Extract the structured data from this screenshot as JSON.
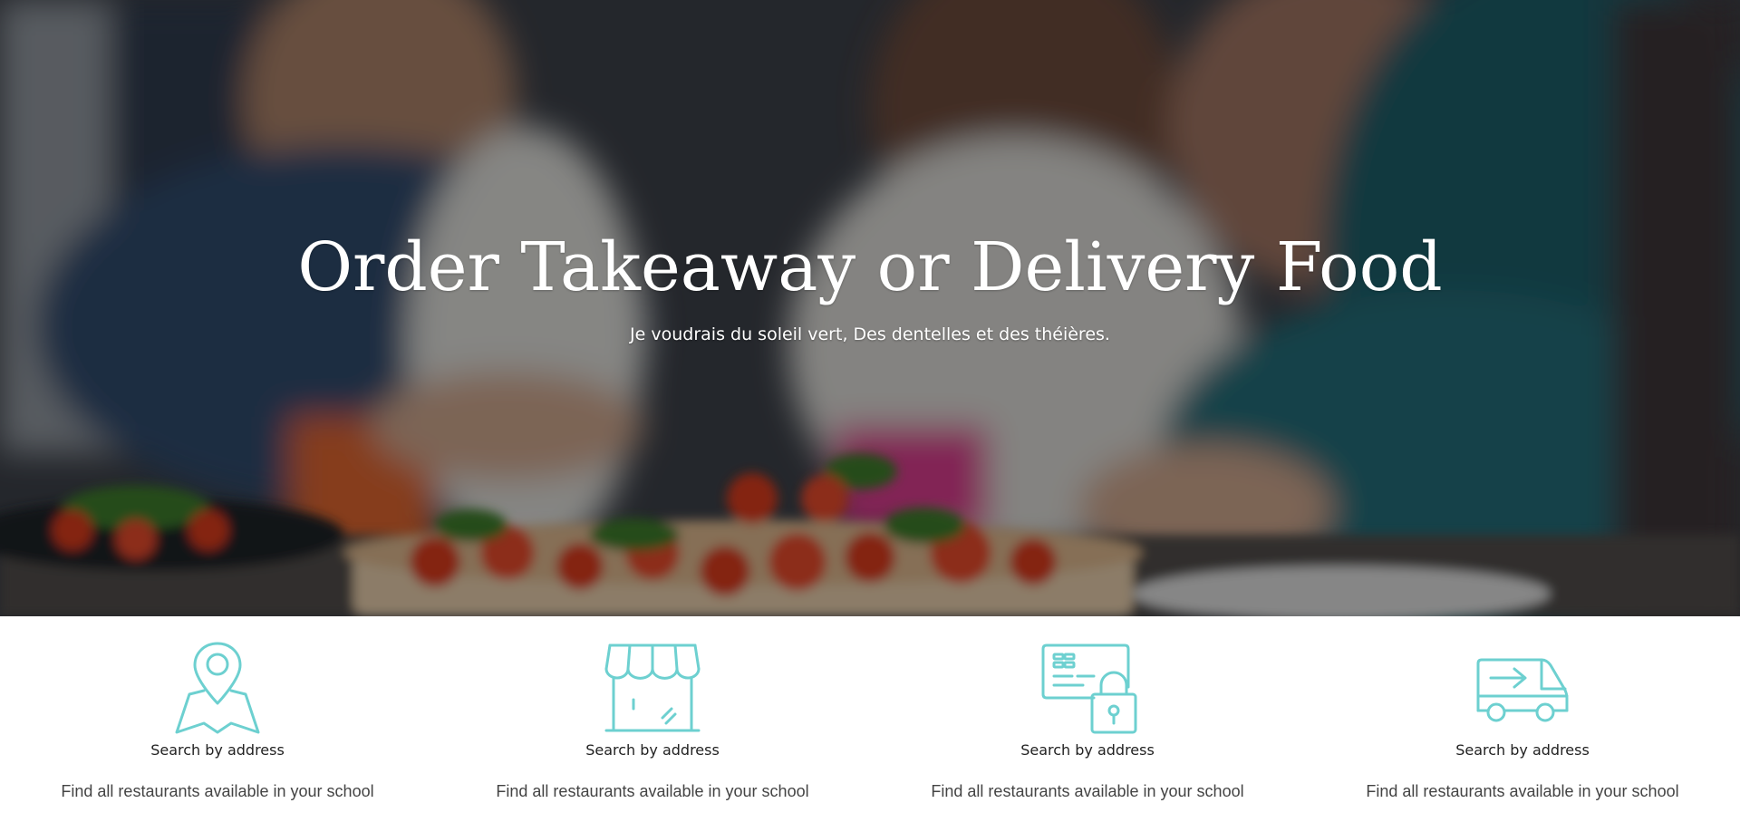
{
  "hero": {
    "title": "Order Takeaway or Delivery Food",
    "subtitle": "Je voudrais du soleil vert, Des dentelles et des théières."
  },
  "features": [
    {
      "icon": "map-pin-icon",
      "title": "Search by address",
      "description": "Find all restaurants available in your school"
    },
    {
      "icon": "storefront-icon",
      "title": "Search by address",
      "description": "Find all restaurants available in your school"
    },
    {
      "icon": "secure-card-icon",
      "title": "Search by address",
      "description": "Find all restaurants available in your school"
    },
    {
      "icon": "delivery-van-icon",
      "title": "Search by address",
      "description": "Find all restaurants available in your school"
    }
  ],
  "colors": {
    "icon_accent": "#6dd0d0",
    "overlay": "#000000"
  }
}
